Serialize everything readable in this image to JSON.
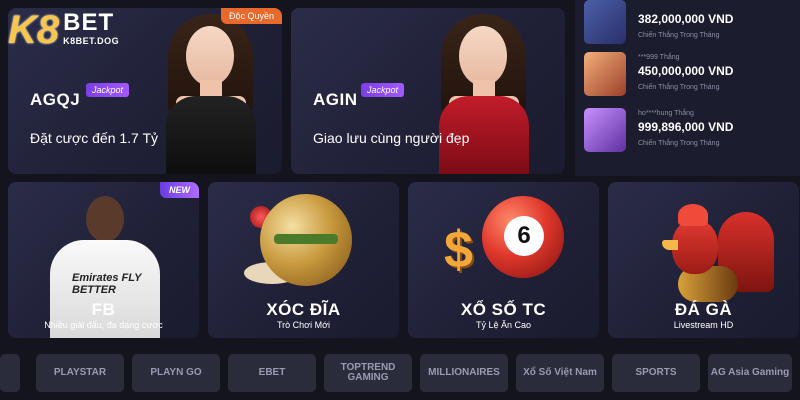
{
  "logo": {
    "mark": "K8",
    "brand": "BET",
    "domain": "K8BET.DOG"
  },
  "top_cards": [
    {
      "title": "AGQJ",
      "jackpot": "Jackpot",
      "subtitle": "Đặt cược đến 1.7 Tỷ",
      "badge": "Độc Quyền"
    },
    {
      "title": "AGIN",
      "jackpot": "Jackpot",
      "subtitle": "Giao lưu cùng người đẹp"
    }
  ],
  "winners": [
    {
      "user": "",
      "amount": "382,000,000 VND",
      "label": "Chiến Thắng Trong Tháng"
    },
    {
      "user": "***999 Thắng",
      "amount": "450,000,000 VND",
      "label": "Chiến Thắng Trong Tháng"
    },
    {
      "user": "ho****hung Thắng",
      "amount": "999,896,000 VND",
      "label": "Chiến Thắng Trong Tháng"
    }
  ],
  "bottom_cards": [
    {
      "title": "FB",
      "subtitle": "Nhiều giải đấu, đa dạng cược",
      "badge": "NEW",
      "shirt_text": "Emirates FLY BETTER"
    },
    {
      "title": "XÓC ĐĨA",
      "subtitle": "Trò Chơi Mới"
    },
    {
      "title": "XỔ SỐ TC",
      "subtitle": "Tỷ Lệ Ăn Cao",
      "ball_number": "6",
      "symbol": "$"
    },
    {
      "title": "ĐÁ GÀ",
      "subtitle": "Livestream HD"
    }
  ],
  "providers": [
    "PLAYSTAR",
    "PLAYN GO",
    "EBET",
    "TOPTREND GAMING",
    "MILLIONAIRES",
    "Xổ Số Việt Nam",
    "SPORTS",
    "AG Asia Gaming"
  ],
  "colors": {
    "background": "#14141f",
    "card": "#2b2c48",
    "badge_orange": "#e8692c",
    "badge_purple": "#8b4cf0",
    "logo_gold": "#f7c64c"
  }
}
